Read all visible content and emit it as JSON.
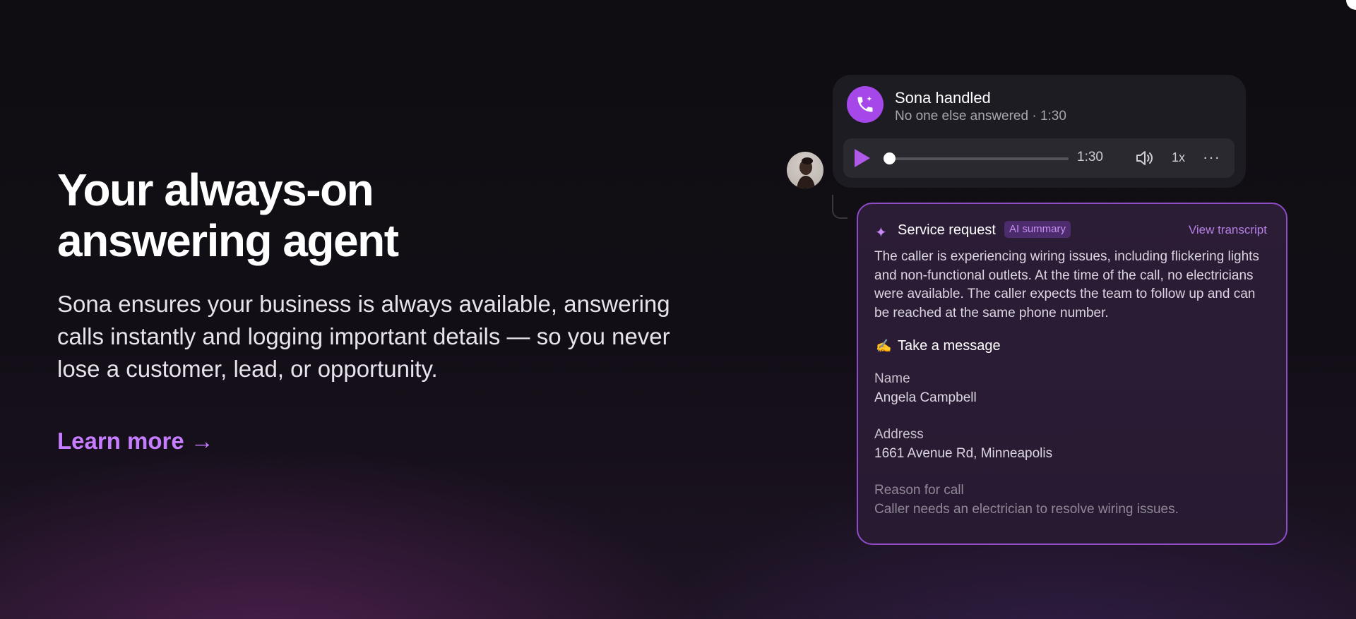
{
  "hero": {
    "title": "Your always-on answering agent",
    "description": "Sona ensures your business is always available, answering calls instantly and logging important details — so you never lose a customer, lead, or opportunity.",
    "cta": "Learn more →"
  },
  "call": {
    "title": "Sona handled",
    "subtitle": "No one else answered · 1:30",
    "player": {
      "time": "1:30",
      "speed": "1x",
      "more": "···",
      "progress": 0
    }
  },
  "summary": {
    "title": "Service request",
    "badge": "AI summary",
    "view_transcript": "View transcript",
    "text": "The caller is experiencing wiring issues, including flickering lights and non-functional outlets. At the time of the call, no electricians were available. The caller expects the team to follow up and can be reached at the same phone number.",
    "message_emoji": "✍️",
    "message_title": "Take a message",
    "fields": [
      {
        "label": "Name",
        "value": "Angela Campbell"
      },
      {
        "label": "Address",
        "value": "1661 Avenue Rd, Minneapolis"
      },
      {
        "label": "Reason for call",
        "value": "Caller needs an electrician to resolve wiring issues."
      }
    ]
  },
  "colors": {
    "accent": "#c77dff",
    "call_icon": "#a647ea",
    "card_border": "#8d4bc6"
  },
  "icons": {
    "call": "phone-sparkle-icon",
    "play": "play-icon",
    "volume": "volume-icon",
    "more": "more-horizontal-icon",
    "sparkle": "sparkle-icon"
  }
}
